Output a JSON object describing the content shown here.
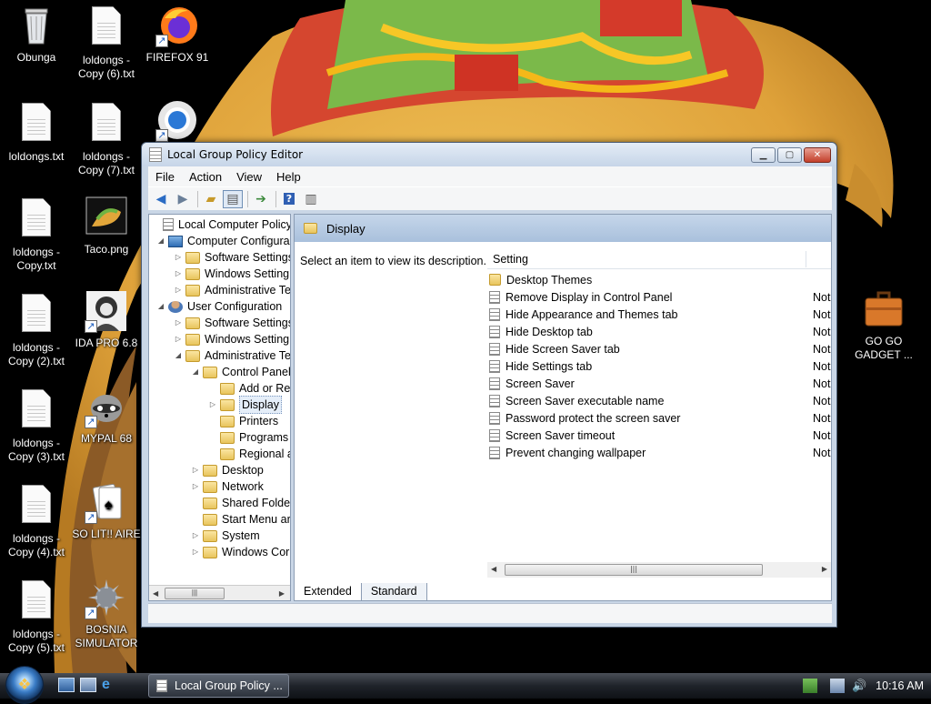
{
  "desktop": {
    "icons": [
      {
        "name": "desktop-icon-obunga",
        "label": "Obunga"
      },
      {
        "name": "desktop-icon-loldongs-copy-6",
        "label": "loldongs - Copy (6).txt"
      },
      {
        "name": "desktop-icon-firefox",
        "label": "FIREFOX 91"
      },
      {
        "name": "desktop-icon-loldongs",
        "label": "loldongs.txt"
      },
      {
        "name": "desktop-icon-loldongs-copy-7",
        "label": "loldongs - Copy (7).txt"
      },
      {
        "name": "desktop-icon-loldongs-copy",
        "label": "loldongs - Copy.txt"
      },
      {
        "name": "desktop-icon-taco",
        "label": "Taco.png"
      },
      {
        "name": "desktop-icon-loldongs-copy-2",
        "label": "loldongs - Copy (2).txt"
      },
      {
        "name": "desktop-icon-ida-pro",
        "label": "IDA PRO 6.8"
      },
      {
        "name": "desktop-icon-loldongs-copy-3",
        "label": "loldongs - Copy (3).txt"
      },
      {
        "name": "desktop-icon-mypal",
        "label": "MYPAL 68"
      },
      {
        "name": "desktop-icon-loldongs-copy-4",
        "label": "loldongs - Copy (4).txt"
      },
      {
        "name": "desktop-icon-so-lit",
        "label": "SO LIT!! AIRE"
      },
      {
        "name": "desktop-icon-loldongs-copy-5",
        "label": "loldongs - Copy (5).txt"
      },
      {
        "name": "desktop-icon-bosnia",
        "label": "BOSNIA SIMULATOR"
      },
      {
        "name": "desktop-icon-go-go-gadget",
        "label": "GO GO GADGET ..."
      }
    ]
  },
  "window": {
    "title": "Local Group Policy Editor",
    "menu": [
      "File",
      "Action",
      "View",
      "Help"
    ],
    "tree": [
      {
        "label": "Local Computer Policy",
        "expand": "",
        "icon": "policy"
      },
      {
        "label": "Computer Configura",
        "expand": "◢",
        "icon": "computer"
      },
      {
        "label": "Software Settings",
        "expand": "▷",
        "icon": "folder"
      },
      {
        "label": "Windows Setting",
        "expand": "▷",
        "icon": "folder"
      },
      {
        "label": "Administrative Te",
        "expand": "▷",
        "icon": "folder"
      },
      {
        "label": "User Configuration",
        "expand": "◢",
        "icon": "user"
      },
      {
        "label": "Software Settings",
        "expand": "▷",
        "icon": "folder"
      },
      {
        "label": "Windows Setting",
        "expand": "▷",
        "icon": "folder"
      },
      {
        "label": "Administrative Te",
        "expand": "◢",
        "icon": "folder"
      },
      {
        "label": "Control Panel",
        "expand": "◢",
        "icon": "folder"
      },
      {
        "label": "Add or Re",
        "expand": "",
        "icon": "folder"
      },
      {
        "label": "Display",
        "expand": "▷",
        "icon": "folder"
      },
      {
        "label": "Printers",
        "expand": "",
        "icon": "folder"
      },
      {
        "label": "Programs",
        "expand": "",
        "icon": "folder"
      },
      {
        "label": "Regional a",
        "expand": "",
        "icon": "folder"
      },
      {
        "label": "Desktop",
        "expand": "▷",
        "icon": "folder"
      },
      {
        "label": "Network",
        "expand": "▷",
        "icon": "folder"
      },
      {
        "label": "Shared Folder",
        "expand": "",
        "icon": "folder"
      },
      {
        "label": "Start Menu ar",
        "expand": "",
        "icon": "folder"
      },
      {
        "label": "System",
        "expand": "▷",
        "icon": "folder"
      },
      {
        "label": "Windows Cor",
        "expand": "▷",
        "icon": "folder"
      }
    ],
    "pane_title": "Display",
    "description": "Select an item to view its description.",
    "column_setting": "Setting",
    "settings": [
      {
        "label": "Desktop Themes",
        "state": "",
        "icon": "folder"
      },
      {
        "label": "Remove Display in Control Panel",
        "state": "Not",
        "icon": "policy"
      },
      {
        "label": "Hide Appearance and Themes tab",
        "state": "Not",
        "icon": "policy"
      },
      {
        "label": "Hide Desktop tab",
        "state": "Not",
        "icon": "policy"
      },
      {
        "label": "Hide Screen Saver tab",
        "state": "Not",
        "icon": "policy"
      },
      {
        "label": "Hide Settings tab",
        "state": "Not",
        "icon": "policy"
      },
      {
        "label": "Screen Saver",
        "state": "Not",
        "icon": "policy"
      },
      {
        "label": "Screen Saver executable name",
        "state": "Not",
        "icon": "policy"
      },
      {
        "label": "Password protect the screen saver",
        "state": "Not",
        "icon": "policy"
      },
      {
        "label": "Screen Saver timeout",
        "state": "Not",
        "icon": "policy"
      },
      {
        "label": "Prevent changing wallpaper",
        "state": "Not",
        "icon": "policy"
      }
    ],
    "tabs": [
      "Extended",
      "Standard"
    ]
  },
  "taskbar": {
    "task_label": "Local Group Policy ...",
    "clock": "10:16 AM"
  }
}
